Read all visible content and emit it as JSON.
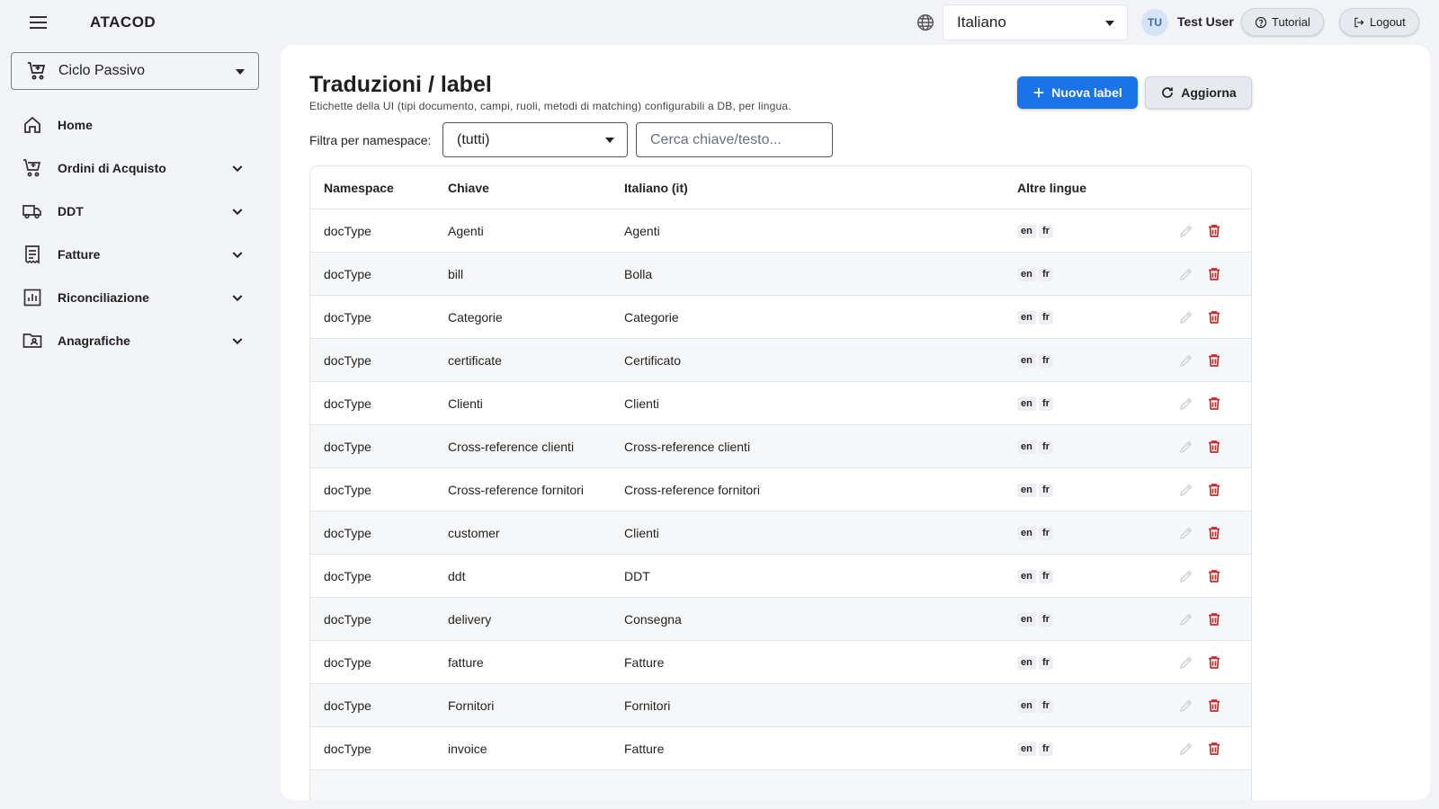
{
  "header": {
    "brand": "ATACOD",
    "language": "Italiano",
    "user_initials": "TU",
    "user_name": "Test User",
    "tutorial_label": "Tutorial",
    "logout_label": "Logout"
  },
  "sidebar": {
    "cycle": "Ciclo Passivo",
    "items": [
      {
        "label": "Home",
        "icon": "home-icon",
        "expandable": false
      },
      {
        "label": "Ordini di Acquisto",
        "icon": "cart-icon",
        "expandable": true
      },
      {
        "label": "DDT",
        "icon": "truck-icon",
        "expandable": true
      },
      {
        "label": "Fatture",
        "icon": "receipt-icon",
        "expandable": true
      },
      {
        "label": "Riconciliazione",
        "icon": "chart-icon",
        "expandable": true
      },
      {
        "label": "Anagrafiche",
        "icon": "contact-folder-icon",
        "expandable": true
      }
    ]
  },
  "main": {
    "title": "Traduzioni / label",
    "subtitle": "Etichette della UI (tipi documento, campi, ruoli, metodi di matching) configurabili a DB, per lingua.",
    "new_label_button": "Nuova label",
    "refresh_button": "Aggiorna",
    "filter_label": "Filtra per namespace:",
    "namespace_value": "(tutti)",
    "search_placeholder": "Cerca chiave/testo...",
    "columns": [
      "Namespace",
      "Chiave",
      "Italiano (it)",
      "Altre lingue"
    ],
    "rows": [
      {
        "namespace": "docType",
        "key": "Agenti",
        "it": "Agenti",
        "langs": [
          "en",
          "fr"
        ]
      },
      {
        "namespace": "docType",
        "key": "bill",
        "it": "Bolla",
        "langs": [
          "en",
          "fr"
        ]
      },
      {
        "namespace": "docType",
        "key": "Categorie",
        "it": "Categorie",
        "langs": [
          "en",
          "fr"
        ]
      },
      {
        "namespace": "docType",
        "key": "certificate",
        "it": "Certificato",
        "langs": [
          "en",
          "fr"
        ]
      },
      {
        "namespace": "docType",
        "key": "Clienti",
        "it": "Clienti",
        "langs": [
          "en",
          "fr"
        ]
      },
      {
        "namespace": "docType",
        "key": "Cross-reference clienti",
        "it": "Cross-reference clienti",
        "langs": [
          "en",
          "fr"
        ]
      },
      {
        "namespace": "docType",
        "key": "Cross-reference fornitori",
        "it": "Cross-reference fornitori",
        "langs": [
          "en",
          "fr"
        ]
      },
      {
        "namespace": "docType",
        "key": "customer",
        "it": "Clienti",
        "langs": [
          "en",
          "fr"
        ]
      },
      {
        "namespace": "docType",
        "key": "ddt",
        "it": "DDT",
        "langs": [
          "en",
          "fr"
        ]
      },
      {
        "namespace": "docType",
        "key": "delivery",
        "it": "Consegna",
        "langs": [
          "en",
          "fr"
        ]
      },
      {
        "namespace": "docType",
        "key": "fatture",
        "it": "Fatture",
        "langs": [
          "en",
          "fr"
        ]
      },
      {
        "namespace": "docType",
        "key": "Fornitori",
        "it": "Fornitori",
        "langs": [
          "en",
          "fr"
        ]
      },
      {
        "namespace": "docType",
        "key": "invoice",
        "it": "Fatture",
        "langs": [
          "en",
          "fr"
        ]
      }
    ]
  },
  "colors": {
    "primary": "#1a73e8",
    "delete": "#c62828",
    "background": "#f1f3f6"
  }
}
